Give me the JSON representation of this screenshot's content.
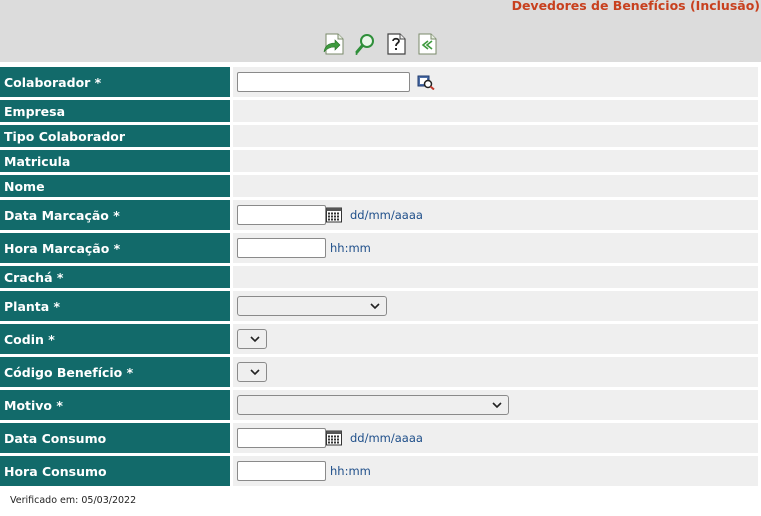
{
  "page": {
    "title": "Devedores de Benefícios (Inclusão)"
  },
  "toolbar": {
    "buttons": [
      {
        "icon": "save-arrow-icon"
      },
      {
        "icon": "search-icon"
      },
      {
        "icon": "help-icon"
      },
      {
        "icon": "back-icon"
      }
    ]
  },
  "form": {
    "colaborador": {
      "label": "Colaborador *",
      "value": ""
    },
    "empresa": {
      "label": "Empresa"
    },
    "tipo_colaborador": {
      "label": "Tipo Colaborador"
    },
    "matricula": {
      "label": "Matricula"
    },
    "nome": {
      "label": "Nome"
    },
    "data_marcacao": {
      "label": "Data Marcação *",
      "value": "",
      "hint": "dd/mm/aaaa"
    },
    "hora_marcacao": {
      "label": "Hora Marcação *",
      "value": "",
      "hint": "hh:mm"
    },
    "cracha": {
      "label": "Crachá *"
    },
    "planta": {
      "label": "Planta *",
      "selected": ""
    },
    "codin": {
      "label": "Codin *",
      "selected": ""
    },
    "codigo_beneficio": {
      "label": "Código Benefício *",
      "selected": ""
    },
    "motivo": {
      "label": "Motivo *",
      "selected": ""
    },
    "data_consumo": {
      "label": "Data Consumo",
      "value": "",
      "hint": "dd/mm/aaaa"
    },
    "hora_consumo": {
      "label": "Hora Consumo",
      "value": "",
      "hint": "hh:mm"
    }
  },
  "footer": {
    "text": "Verificado em: 05/03/2022"
  }
}
